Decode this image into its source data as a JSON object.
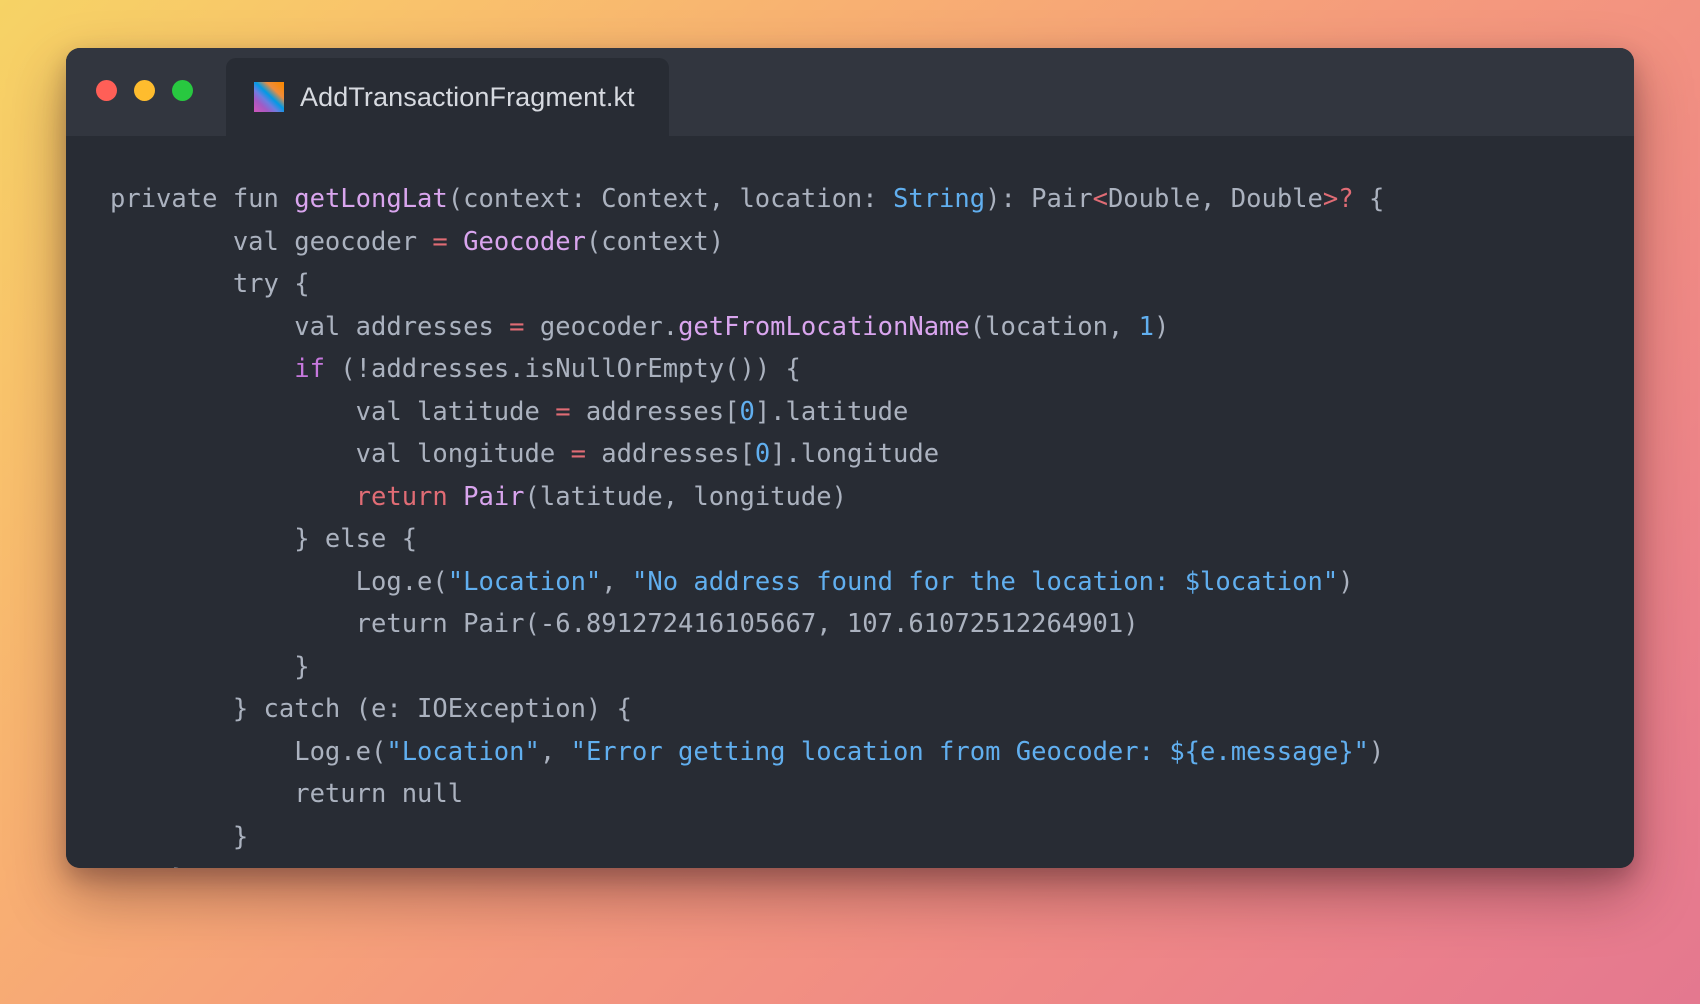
{
  "window": {
    "traffic_lights": [
      {
        "name": "close",
        "color": "#ff5f57"
      },
      {
        "name": "minimize",
        "color": "#febc2e"
      },
      {
        "name": "maximize",
        "color": "#28c840"
      }
    ],
    "tab": {
      "icon": "kotlin-logo-icon",
      "title": "AddTransactionFragment.kt"
    },
    "background_color": "#282c34",
    "titlebar_color": "#32363f"
  },
  "theme": {
    "page_gradient_start": "#f6d365",
    "page_gradient_end": "#e4788f",
    "default_text": "#abb2bf",
    "keyword": "#c678dd",
    "function": "#d9a5ee",
    "type": "#61afef",
    "string": "#61afef",
    "number": "#61afef",
    "operator": "#e06c75",
    "return_keyword": "#e06c75"
  },
  "code": {
    "language": "kotlin",
    "filename": "AddTransactionFragment.kt",
    "lines": [
      [
        {
          "t": "private fun ",
          "c": "t-def"
        },
        {
          "t": "getLongLat",
          "c": "t-fn"
        },
        {
          "t": "(context: Context, location: ",
          "c": "t-def"
        },
        {
          "t": "String",
          "c": "t-type"
        },
        {
          "t": "): Pair",
          "c": "t-def"
        },
        {
          "t": "<",
          "c": "t-op"
        },
        {
          "t": "Double, Double",
          "c": "t-def"
        },
        {
          "t": ">?",
          "c": "t-op"
        },
        {
          "t": " {",
          "c": "t-def"
        }
      ],
      [
        {
          "t": "        val geocoder ",
          "c": "t-def"
        },
        {
          "t": "=",
          "c": "t-op"
        },
        {
          "t": " ",
          "c": "t-def"
        },
        {
          "t": "Geocoder",
          "c": "t-fn"
        },
        {
          "t": "(context)",
          "c": "t-def"
        }
      ],
      [
        {
          "t": "        try {",
          "c": "t-def"
        }
      ],
      [
        {
          "t": "            val addresses ",
          "c": "t-def"
        },
        {
          "t": "=",
          "c": "t-op"
        },
        {
          "t": " geocoder.",
          "c": "t-def"
        },
        {
          "t": "getFromLocationName",
          "c": "t-fn"
        },
        {
          "t": "(location, ",
          "c": "t-def"
        },
        {
          "t": "1",
          "c": "t-num"
        },
        {
          "t": ")",
          "c": "t-def"
        }
      ],
      [
        {
          "t": "            ",
          "c": "t-def"
        },
        {
          "t": "if",
          "c": "t-kw"
        },
        {
          "t": " (!addresses.isNullOrEmpty()) {",
          "c": "t-def"
        }
      ],
      [
        {
          "t": "                val latitude ",
          "c": "t-def"
        },
        {
          "t": "=",
          "c": "t-op"
        },
        {
          "t": " addresses[",
          "c": "t-def"
        },
        {
          "t": "0",
          "c": "t-num"
        },
        {
          "t": "].latitude",
          "c": "t-def"
        }
      ],
      [
        {
          "t": "                val longitude ",
          "c": "t-def"
        },
        {
          "t": "=",
          "c": "t-op"
        },
        {
          "t": " addresses[",
          "c": "t-def"
        },
        {
          "t": "0",
          "c": "t-num"
        },
        {
          "t": "].longitude",
          "c": "t-def"
        }
      ],
      [
        {
          "t": "                ",
          "c": "t-def"
        },
        {
          "t": "return",
          "c": "t-ret"
        },
        {
          "t": " ",
          "c": "t-def"
        },
        {
          "t": "Pair",
          "c": "t-fn"
        },
        {
          "t": "(latitude, longitude)",
          "c": "t-def"
        }
      ],
      [
        {
          "t": "            } else {",
          "c": "t-def"
        }
      ],
      [
        {
          "t": "                Log.e(",
          "c": "t-def"
        },
        {
          "t": "\"Location\"",
          "c": "t-str"
        },
        {
          "t": ", ",
          "c": "t-def"
        },
        {
          "t": "\"No address found for the location: $location\"",
          "c": "t-str"
        },
        {
          "t": ")",
          "c": "t-def"
        }
      ],
      [
        {
          "t": "                return Pair(-6.891272416105667, 107.61072512264901)",
          "c": "t-plain"
        }
      ],
      [
        {
          "t": "            }",
          "c": "t-def"
        }
      ],
      [
        {
          "t": "        } catch (e: IOException) {",
          "c": "t-def"
        }
      ],
      [
        {
          "t": "            Log.e(",
          "c": "t-def"
        },
        {
          "t": "\"Location\"",
          "c": "t-str"
        },
        {
          "t": ", ",
          "c": "t-def"
        },
        {
          "t": "\"Error getting location from Geocoder: ${e.message}\"",
          "c": "t-str"
        },
        {
          "t": ")",
          "c": "t-def"
        }
      ],
      [
        {
          "t": "            return null",
          "c": "t-plain"
        }
      ],
      [
        {
          "t": "        }",
          "c": "t-def"
        }
      ],
      [
        {
          "t": "    }",
          "c": "t-def"
        }
      ]
    ]
  }
}
